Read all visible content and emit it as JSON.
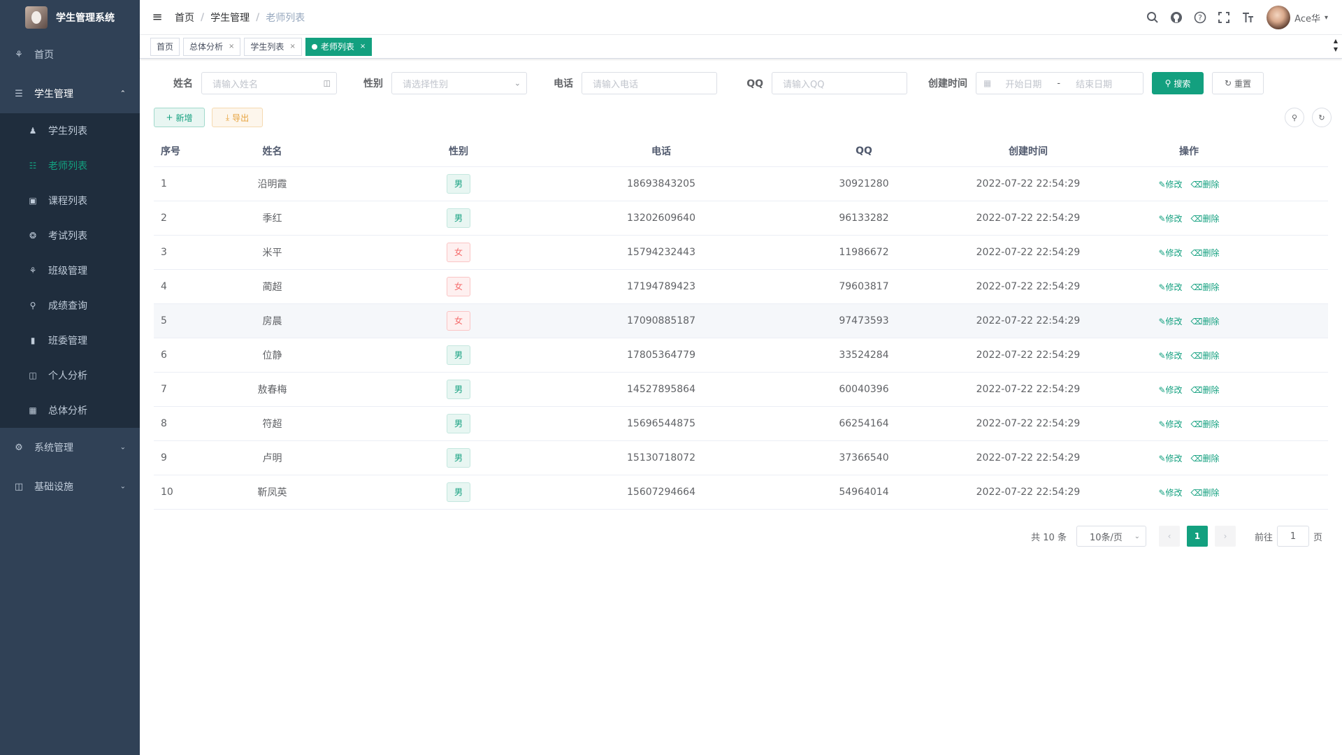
{
  "app": {
    "title": "学生管理系统"
  },
  "sidebar": {
    "home": "首页",
    "student_mgmt": "学生管理",
    "sub_items": [
      {
        "label": "学生列表",
        "icon": "user-icon"
      },
      {
        "label": "老师列表",
        "icon": "teacher-icon"
      },
      {
        "label": "课程列表",
        "icon": "course-icon"
      },
      {
        "label": "考试列表",
        "icon": "exam-icon"
      },
      {
        "label": "班级管理",
        "icon": "class-icon"
      },
      {
        "label": "成绩查询",
        "icon": "search-icon"
      },
      {
        "label": "班委管理",
        "icon": "committee-icon"
      },
      {
        "label": "个人分析",
        "icon": "chart-icon"
      },
      {
        "label": "总体分析",
        "icon": "grid-icon"
      }
    ],
    "system_mgmt": "系统管理",
    "infrastructure": "基础设施"
  },
  "navbar": {
    "breadcrumb": [
      "首页",
      "学生管理",
      "老师列表"
    ],
    "user_name": "Ace华"
  },
  "tags": [
    {
      "label": "首页"
    },
    {
      "label": "总体分析"
    },
    {
      "label": "学生列表"
    },
    {
      "label": "老师列表"
    }
  ],
  "search": {
    "name_label": "姓名",
    "name_placeholder": "请输入姓名",
    "gender_label": "性别",
    "gender_placeholder": "请选择性别",
    "phone_label": "电话",
    "phone_placeholder": "请输入电话",
    "qq_label": "QQ",
    "qq_placeholder": "请输入QQ",
    "time_label": "创建时间",
    "start_placeholder": "开始日期",
    "range_sep": "-",
    "end_placeholder": "结束日期",
    "search_btn": "搜索",
    "reset_btn": "重置"
  },
  "toolbar": {
    "add": "新增",
    "export": "导出"
  },
  "table": {
    "headers": [
      "序号",
      "姓名",
      "性别",
      "电话",
      "QQ",
      "创建时间",
      "操作"
    ],
    "edit_label": "修改",
    "delete_label": "删除",
    "rows": [
      {
        "no": "1",
        "name": "沿明霞",
        "gender": "男",
        "phone": "18693843205",
        "qq": "30921280",
        "time": "2022-07-22 22:54:29"
      },
      {
        "no": "2",
        "name": "季红",
        "gender": "男",
        "phone": "13202609640",
        "qq": "96133282",
        "time": "2022-07-22 22:54:29"
      },
      {
        "no": "3",
        "name": "米平",
        "gender": "女",
        "phone": "15794232443",
        "qq": "11986672",
        "time": "2022-07-22 22:54:29"
      },
      {
        "no": "4",
        "name": "蔺超",
        "gender": "女",
        "phone": "17194789423",
        "qq": "79603817",
        "time": "2022-07-22 22:54:29"
      },
      {
        "no": "5",
        "name": "房晨",
        "gender": "女",
        "phone": "17090885187",
        "qq": "97473593",
        "time": "2022-07-22 22:54:29"
      },
      {
        "no": "6",
        "name": "位静",
        "gender": "男",
        "phone": "17805364779",
        "qq": "33524284",
        "time": "2022-07-22 22:54:29"
      },
      {
        "no": "7",
        "name": "敖春梅",
        "gender": "男",
        "phone": "14527895864",
        "qq": "60040396",
        "time": "2022-07-22 22:54:29"
      },
      {
        "no": "8",
        "name": "符超",
        "gender": "男",
        "phone": "15696544875",
        "qq": "66254164",
        "time": "2022-07-22 22:54:29"
      },
      {
        "no": "9",
        "name": "卢明",
        "gender": "男",
        "phone": "15130718072",
        "qq": "37366540",
        "time": "2022-07-22 22:54:29"
      },
      {
        "no": "10",
        "name": "靳凤英",
        "gender": "男",
        "phone": "15607294664",
        "qq": "54964014",
        "time": "2022-07-22 22:54:29"
      }
    ]
  },
  "pagination": {
    "total": "共 10 条",
    "page_size": "10条/页",
    "current": "1",
    "goto_label": "前往",
    "goto_value": "1",
    "page_suffix": "页"
  },
  "colors": {
    "primary": "#13a07f",
    "sidebar_bg": "#304156",
    "submenu_bg": "#1f2d3d",
    "female": "#f56c6c"
  }
}
